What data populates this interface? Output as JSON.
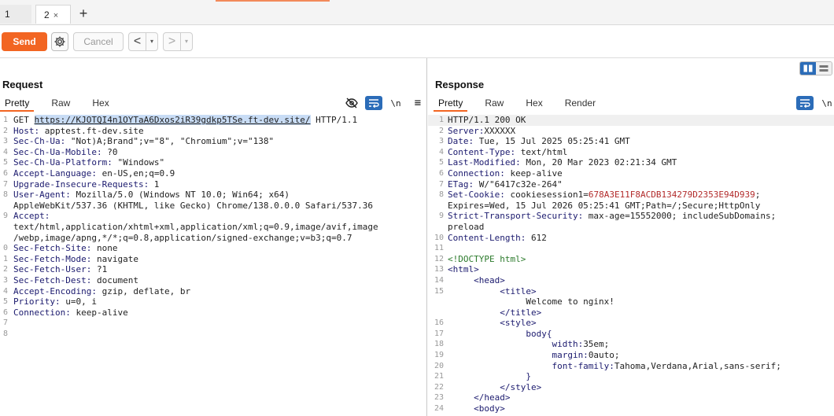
{
  "tabs": [
    {
      "label": "1"
    },
    {
      "label": "2",
      "close": "×"
    }
  ],
  "add_tab_label": "+",
  "toolbar": {
    "send_label": "Send",
    "cancel_label": "Cancel",
    "back_label": "<",
    "forward_label": ">",
    "dropdown_glyph": "▾"
  },
  "request": {
    "title": "Request",
    "tabs": [
      "Pretty",
      "Raw",
      "Hex"
    ],
    "active_tab": "Pretty",
    "newline_label": "\\n",
    "menu_label": "≡",
    "lines": [
      {
        "n": "1",
        "segs": [
          {
            "t": "GET ",
            "c": ""
          },
          {
            "t": "https://KJOTQI4n1OYTaA6Dxos2iR39gdkp5TSe.ft-dev.site/",
            "c": "sel"
          },
          {
            "t": " HTTP/1.1",
            "c": ""
          }
        ]
      },
      {
        "n": "2",
        "segs": [
          {
            "t": "Host:",
            "c": "k"
          },
          {
            "t": " apptest.ft-dev.site",
            "c": ""
          }
        ]
      },
      {
        "n": "3",
        "segs": [
          {
            "t": "Sec-Ch-Ua:",
            "c": "k"
          },
          {
            "t": " \"Not)A;Brand\";v=\"8\", \"Chromium\";v=\"138\"",
            "c": ""
          }
        ]
      },
      {
        "n": "4",
        "segs": [
          {
            "t": "Sec-Ch-Ua-Mobile:",
            "c": "k"
          },
          {
            "t": " ?0",
            "c": ""
          }
        ]
      },
      {
        "n": "5",
        "segs": [
          {
            "t": "Sec-Ch-Ua-Platform:",
            "c": "k"
          },
          {
            "t": " \"Windows\"",
            "c": ""
          }
        ]
      },
      {
        "n": "6",
        "segs": [
          {
            "t": "Accept-Language:",
            "c": "k"
          },
          {
            "t": " en-US,en;q=0.9",
            "c": ""
          }
        ]
      },
      {
        "n": "7",
        "segs": [
          {
            "t": "Upgrade-Insecure-Requests:",
            "c": "k"
          },
          {
            "t": " 1",
            "c": ""
          }
        ]
      },
      {
        "n": "8",
        "segs": [
          {
            "t": "User-Agent:",
            "c": "k"
          },
          {
            "t": " Mozilla/5.0 (Windows NT 10.0; Win64; x64)",
            "c": ""
          }
        ]
      },
      {
        "n": "",
        "segs": [
          {
            "t": "AppleWebKit/537.36 (KHTML, like Gecko) Chrome/138.0.0.0 Safari/537.36",
            "c": ""
          }
        ]
      },
      {
        "n": "9",
        "segs": [
          {
            "t": "Accept:",
            "c": "k"
          }
        ]
      },
      {
        "n": "",
        "segs": [
          {
            "t": "text/html,application/xhtml+xml,application/xml;q=0.9,image/avif,image",
            "c": ""
          }
        ]
      },
      {
        "n": "",
        "segs": [
          {
            "t": "/webp,image/apng,*/*;q=0.8,application/signed-exchange;v=b3;q=0.7",
            "c": ""
          }
        ]
      },
      {
        "n": "0",
        "segs": [
          {
            "t": "Sec-Fetch-Site:",
            "c": "k"
          },
          {
            "t": " none",
            "c": ""
          }
        ]
      },
      {
        "n": "1",
        "segs": [
          {
            "t": "Sec-Fetch-Mode:",
            "c": "k"
          },
          {
            "t": " navigate",
            "c": ""
          }
        ]
      },
      {
        "n": "2",
        "segs": [
          {
            "t": "Sec-Fetch-User:",
            "c": "k"
          },
          {
            "t": " ?1",
            "c": ""
          }
        ]
      },
      {
        "n": "3",
        "segs": [
          {
            "t": "Sec-Fetch-Dest:",
            "c": "k"
          },
          {
            "t": " document",
            "c": ""
          }
        ]
      },
      {
        "n": "4",
        "segs": [
          {
            "t": "Accept-Encoding:",
            "c": "k"
          },
          {
            "t": " gzip, deflate, br",
            "c": ""
          }
        ]
      },
      {
        "n": "5",
        "segs": [
          {
            "t": "Priority:",
            "c": "k"
          },
          {
            "t": " u=0, i",
            "c": ""
          }
        ]
      },
      {
        "n": "6",
        "segs": [
          {
            "t": "Connection:",
            "c": "k"
          },
          {
            "t": " keep-alive",
            "c": ""
          }
        ]
      },
      {
        "n": "7",
        "segs": []
      },
      {
        "n": "8",
        "segs": []
      }
    ]
  },
  "response": {
    "title": "Response",
    "tabs": [
      "Pretty",
      "Raw",
      "Hex",
      "Render"
    ],
    "active_tab": "Pretty",
    "newline_label": "\\n",
    "lines": [
      {
        "n": "1",
        "segs": [
          {
            "t": "HTTP/1.1 200 OK",
            "c": ""
          }
        ]
      },
      {
        "n": "2",
        "segs": [
          {
            "t": "Server:",
            "c": "k"
          },
          {
            "t": "XXXXXX",
            "c": ""
          }
        ]
      },
      {
        "n": "3",
        "segs": [
          {
            "t": "Date:",
            "c": "k"
          },
          {
            "t": " Tue, 15 Jul 2025 05:25:41 GMT",
            "c": ""
          }
        ]
      },
      {
        "n": "4",
        "segs": [
          {
            "t": "Content-Type:",
            "c": "k"
          },
          {
            "t": " text/html",
            "c": ""
          }
        ]
      },
      {
        "n": "5",
        "segs": [
          {
            "t": "Last-Modified:",
            "c": "k"
          },
          {
            "t": " Mon, 20 Mar 2023 02:21:34 GMT",
            "c": ""
          }
        ]
      },
      {
        "n": "6",
        "segs": [
          {
            "t": "Connection:",
            "c": "k"
          },
          {
            "t": " keep-alive",
            "c": ""
          }
        ]
      },
      {
        "n": "7",
        "segs": [
          {
            "t": "ETag:",
            "c": "k"
          },
          {
            "t": " W/\"6417c32e-264\"",
            "c": ""
          }
        ]
      },
      {
        "n": "8",
        "segs": [
          {
            "t": "Set-Cookie:",
            "c": "k"
          },
          {
            "t": " cookiesession1=",
            "c": ""
          },
          {
            "t": "678A3E11F8ACDB134279D2353E94D939",
            "c": "cookie"
          },
          {
            "t": ";",
            "c": ""
          }
        ]
      },
      {
        "n": "",
        "segs": [
          {
            "t": "Expires=Wed, 15 Jul 2026 05:25:41 GMT;Path=/;Secure;HttpOnly",
            "c": ""
          }
        ]
      },
      {
        "n": "9",
        "segs": [
          {
            "t": "Strict-Transport-Security:",
            "c": "k"
          },
          {
            "t": " max-age=15552000; includeSubDomains;",
            "c": ""
          }
        ]
      },
      {
        "n": "",
        "segs": [
          {
            "t": "preload",
            "c": ""
          }
        ]
      },
      {
        "n": "10",
        "segs": [
          {
            "t": "Content-Length:",
            "c": "k"
          },
          {
            "t": " 612",
            "c": ""
          }
        ]
      },
      {
        "n": "11",
        "segs": []
      },
      {
        "n": "12",
        "segs": [
          {
            "t": "<!DOCTYPE html>",
            "c": "doctype"
          }
        ]
      },
      {
        "n": "13",
        "segs": [
          {
            "t": "<html>",
            "c": "tag"
          }
        ]
      },
      {
        "n": "14",
        "segs": [
          {
            "t": "     <head>",
            "c": "tag"
          }
        ]
      },
      {
        "n": "15",
        "segs": [
          {
            "t": "          <title>",
            "c": "tag"
          }
        ]
      },
      {
        "n": "",
        "segs": [
          {
            "t": "               Welcome to nginx!",
            "c": ""
          }
        ]
      },
      {
        "n": "",
        "segs": [
          {
            "t": "          </title>",
            "c": "tag"
          }
        ]
      },
      {
        "n": "16",
        "segs": [
          {
            "t": "          <style>",
            "c": "tag"
          }
        ]
      },
      {
        "n": "17",
        "segs": [
          {
            "t": "               body{",
            "c": "tag"
          }
        ]
      },
      {
        "n": "18",
        "segs": [
          {
            "t": "                    width:",
            "c": "cssp"
          },
          {
            "t": "35em;",
            "c": "cssv"
          }
        ]
      },
      {
        "n": "19",
        "segs": [
          {
            "t": "                    margin:",
            "c": "cssp"
          },
          {
            "t": "0auto;",
            "c": "cssv"
          }
        ]
      },
      {
        "n": "20",
        "segs": [
          {
            "t": "                    font-family:",
            "c": "cssp"
          },
          {
            "t": "Tahoma,Verdana,Arial,sans-serif;",
            "c": "cssv"
          }
        ]
      },
      {
        "n": "21",
        "segs": [
          {
            "t": "               }",
            "c": "tag"
          }
        ]
      },
      {
        "n": "22",
        "segs": [
          {
            "t": "          </style>",
            "c": "tag"
          }
        ]
      },
      {
        "n": "23",
        "segs": [
          {
            "t": "     </head>",
            "c": "tag"
          }
        ]
      },
      {
        "n": "24",
        "segs": [
          {
            "t": "     <body>",
            "c": "tag"
          }
        ]
      }
    ]
  },
  "colors": {
    "accent": "#f26522",
    "tool_blue": "#2b6cb8",
    "header_name": "#1b1a6e",
    "cookie_value": "#b22b2b",
    "selection": "#c8dcf5"
  },
  "icons": [
    "gear-icon",
    "eye-off-icon",
    "wrap-icon",
    "newline-icon",
    "menu-icon",
    "layout-split-icon",
    "layout-stack-icon"
  ]
}
